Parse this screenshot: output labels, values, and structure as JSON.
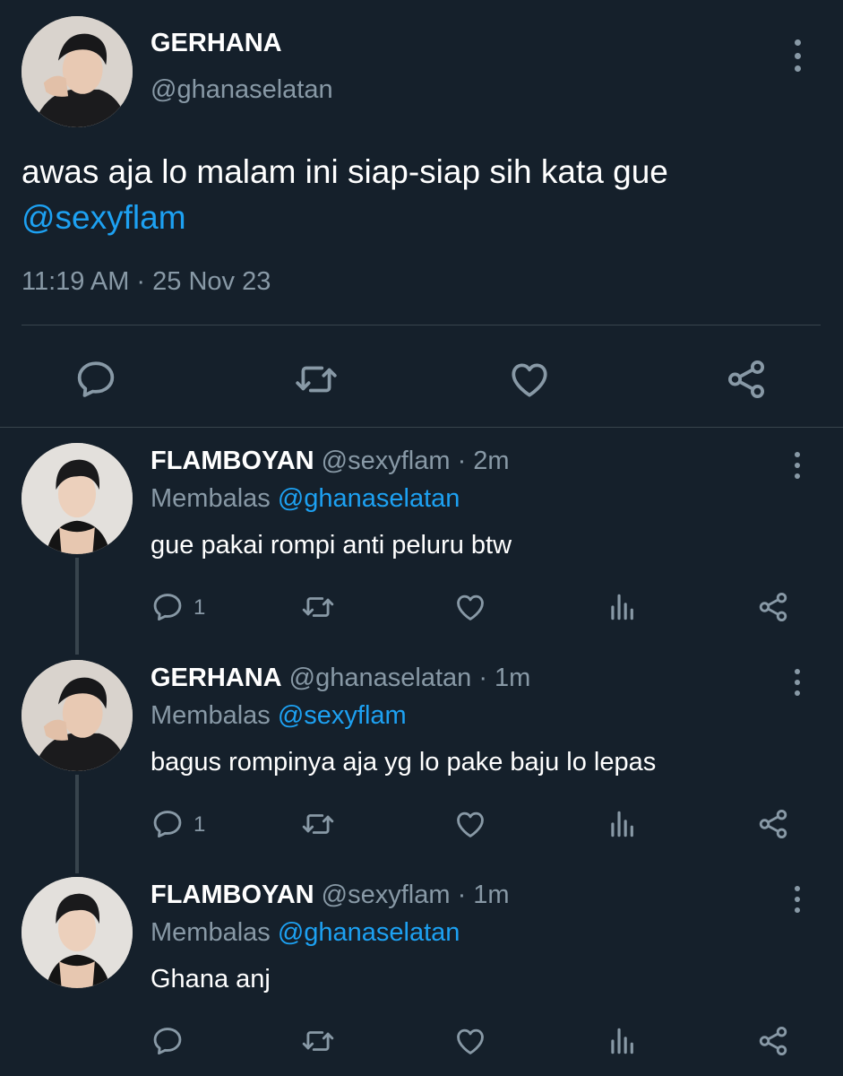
{
  "main_tweet": {
    "name": "GERHANA",
    "handle": "@ghanaselatan",
    "text": "awas aja lo malam ini siap-siap sih kata gue ",
    "mention": "@sexyflam",
    "timestamp": "11:19 AM · 25 Nov 23",
    "actions": [
      "reply-icon",
      "retweet-icon",
      "like-icon",
      "share-icon"
    ]
  },
  "replies": [
    {
      "name": "FLAMBOYAN",
      "meta": " @sexyflam · 2m",
      "replying_label": "Membalas ",
      "replying_to": "@ghanaselatan",
      "text": "gue pakai rompi anti peluru btw",
      "reply_count": "1",
      "actions": [
        "reply-icon",
        "retweet-icon",
        "like-icon",
        "analytics-icon",
        "share-icon"
      ]
    },
    {
      "name": "GERHANA",
      "meta": " @ghanaselatan · 1m",
      "replying_label": "Membalas ",
      "replying_to": "@sexyflam",
      "text": "bagus rompinya aja yg lo pake baju lo lepas",
      "reply_count": "1",
      "actions": [
        "reply-icon",
        "retweet-icon",
        "like-icon",
        "analytics-icon",
        "share-icon"
      ]
    },
    {
      "name": "FLAMBOYAN",
      "meta": " @sexyflam · 1m",
      "replying_label": "Membalas ",
      "replying_to": "@ghanaselatan",
      "text": "Ghana anj",
      "reply_count": "",
      "actions": [
        "reply-icon",
        "retweet-icon",
        "like-icon",
        "analytics-icon",
        "share-icon"
      ]
    }
  ],
  "colors": {
    "background": "#15202b",
    "text_primary": "#ffffff",
    "text_secondary": "#8899a6",
    "accent": "#1da1f2",
    "divider": "#38444d"
  }
}
